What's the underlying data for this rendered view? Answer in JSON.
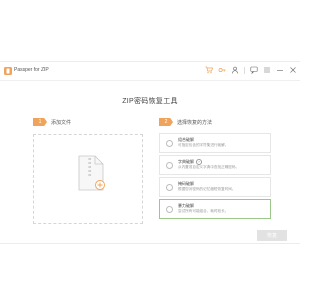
{
  "window": {
    "title": "Passper for ZIP"
  },
  "toolbar": {
    "icons": [
      "cart-icon",
      "key-icon",
      "user-icon",
      "feedback-icon",
      "menu-icon",
      "minimize-icon",
      "close-icon"
    ]
  },
  "main": {
    "title": "ZIP密码恢复工具",
    "step1": {
      "number": "1",
      "label": "添加文件"
    },
    "step2": {
      "number": "2",
      "label": "选择恢复的方法"
    },
    "options": [
      {
        "title": "组合破解",
        "desc": "可指定包含的字符集进行破解。"
      },
      {
        "title": "字典破解",
        "desc": "从内置或自定义字典中查找正确密码。",
        "help": "?"
      },
      {
        "title": "掩码破解",
        "desc": "根据您对密码的记忆缩短恢复时间。"
      },
      {
        "title": "暴力破解",
        "desc": "尝试所有可能组合，耗时较长。"
      }
    ],
    "selected_option": 3,
    "next_label": "恢复"
  },
  "colors": {
    "accent": "#f0a35a",
    "selected_border": "#9bc78a",
    "button_disabled": "#e2e2e2"
  }
}
